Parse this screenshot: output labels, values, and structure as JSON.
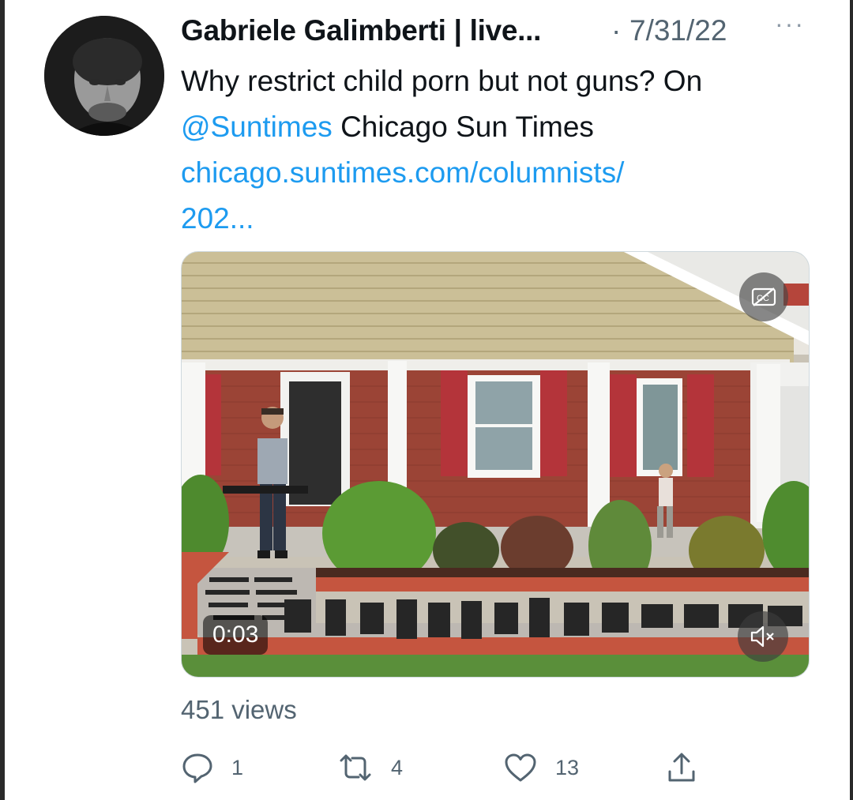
{
  "tweet": {
    "author_name": "Gabriele Galimberti | live...",
    "separator": "·",
    "date": "7/31/22",
    "more_label": "···",
    "text_line1": "Why restrict child porn but not guns? On",
    "mention": "@Suntimes",
    "text_after_mention": " Chicago Sun Times",
    "link_line1": "chicago.suntimes.com/columnists/",
    "link_line2": "202..."
  },
  "media": {
    "type": "video",
    "elapsed_time": "0:03",
    "captions_icon": "captions-off-icon",
    "mute_icon": "speaker-muted-icon",
    "muted": true
  },
  "stats": {
    "views": "451 views",
    "reply_count": "1",
    "retweet_count": "4",
    "like_count": "13"
  },
  "icons": {
    "reply": "reply-icon",
    "retweet": "retweet-icon",
    "like": "heart-icon",
    "share": "share-icon"
  },
  "colors": {
    "link": "#1d9bf0",
    "secondary_text": "#536471",
    "primary_text": "#0f1419"
  }
}
